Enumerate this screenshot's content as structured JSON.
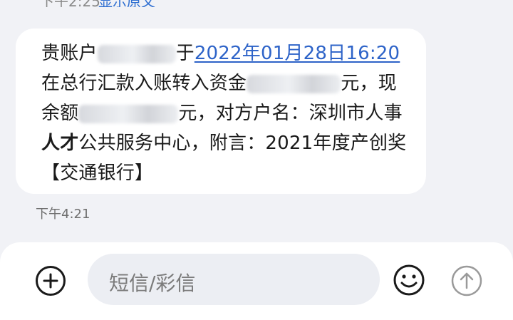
{
  "top_partial": {
    "time": "下午2:25",
    "link": "显示原文"
  },
  "message": {
    "segments": [
      {
        "type": "text",
        "text": "贵账户"
      },
      {
        "type": "redacted"
      },
      {
        "type": "text",
        "text": "于"
      },
      {
        "type": "link",
        "text": "2022年01月28日16:20"
      },
      {
        "type": "text",
        "text": "在总行汇款入账转入资金"
      },
      {
        "type": "redacted"
      },
      {
        "type": "text",
        "text": "元，现余额"
      },
      {
        "type": "redacted"
      },
      {
        "type": "text",
        "text": "元，对方户名：深圳市人事"
      },
      {
        "type": "bold",
        "text": "人才"
      },
      {
        "type": "text",
        "text": "公共服务中心，附言：2021年度产创奖【交通银行】"
      }
    ]
  },
  "timestamp": "下午4:21",
  "composer": {
    "placeholder": "短信/彩信",
    "icons": {
      "add": "plus-circle-icon",
      "emoji": "smiley-icon",
      "send": "arrow-up-circle-icon"
    }
  },
  "colors": {
    "background": "#f1f2f6",
    "bubble": "#ffffff",
    "link": "#2d63c8",
    "muted": "#7b7b7b",
    "send_disabled": "#9a9a9a"
  }
}
